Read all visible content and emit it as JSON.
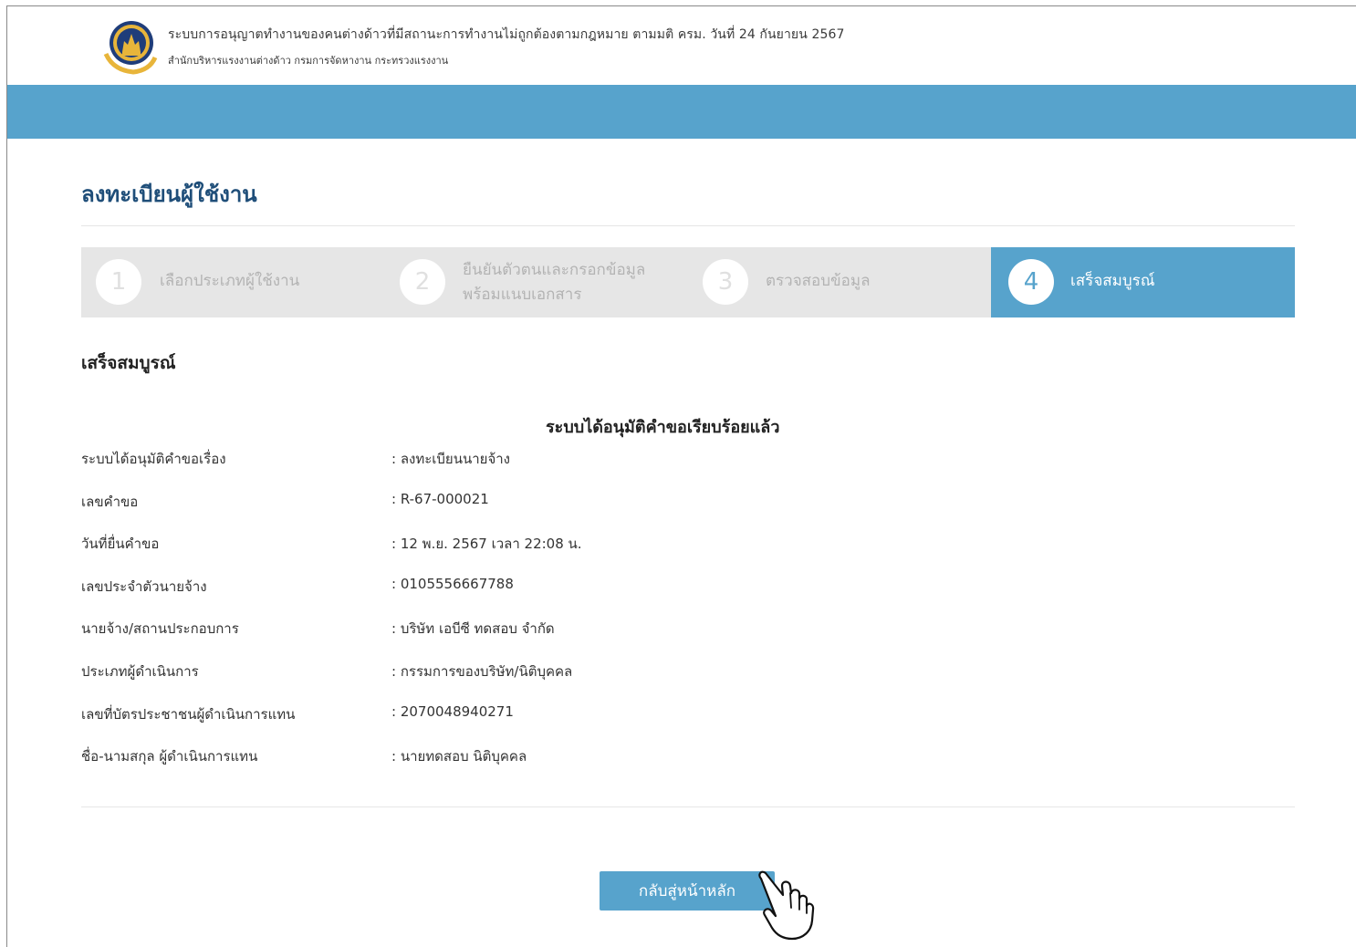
{
  "header": {
    "title": "ระบบการอนุญาตทำงานของคนต่างด้าวที่มีสถานะการทำงานไม่ถูกต้องตามกฎหมาย ตามมติ ครม. วันที่ 24 กันยายน 2567",
    "subtitle": "สำนักบริหารแรงงานต่างด้าว  กรมการจัดหางาน  กระทรวงแรงงาน",
    "logo_icon": "department-seal-icon"
  },
  "page": {
    "title": "ลงทะเบียนผู้ใช้งาน"
  },
  "stepper": {
    "steps": [
      {
        "number": "1",
        "label": "เลือกประเภทผู้ใช้งาน",
        "label_line2": "",
        "active": false
      },
      {
        "number": "2",
        "label": "ยืนยันตัวตนและกรอกข้อมูล",
        "label_line2": "พร้อมแนบเอกสาร",
        "active": false
      },
      {
        "number": "3",
        "label": "ตรวจสอบข้อมูล",
        "label_line2": "",
        "active": false
      },
      {
        "number": "4",
        "label": "เสร็จสมบูรณ์",
        "label_line2": "",
        "active": true
      }
    ],
    "active_color": "#57a3cc",
    "inactive_color": "#e6e6e6"
  },
  "result": {
    "heading": "เสร็จสมบูรณ์",
    "message": "ระบบได้อนุมัติคำขอเรียบร้อยแล้ว",
    "details": [
      {
        "label": "ระบบได้อนุมัติคำขอเรื่อง",
        "value": ": ลงทะเบียนนายจ้าง"
      },
      {
        "label": "เลขคำขอ",
        "value": ": R-67-000021"
      },
      {
        "label": "วันที่ยื่นคำขอ",
        "value": ": 12 พ.ย. 2567 เวลา 22:08 น."
      },
      {
        "label": "เลขประจำตัวนายจ้าง",
        "value": ": 0105556667788"
      },
      {
        "label": "นายจ้าง/สถานประกอบการ",
        "value": ": บริษัท เอบีซี ทดสอบ จำกัด"
      },
      {
        "label": "ประเภทผู้ดำเนินการ",
        "value": ": กรรมการของบริษัท/นิติบุคคล"
      },
      {
        "label": "เลขที่บัตรประชาชนผู้ดำเนินการแทน",
        "value": ": 2070048940271"
      },
      {
        "label": "ชื่อ-นามสกุล ผู้ดำเนินการแทน",
        "value": ": นายทดสอบ นิติบุคคล"
      }
    ]
  },
  "actions": {
    "home_label": "กลับสู่หน้าหลัก",
    "cursor_icon": "hand-pointer-icon"
  },
  "colors": {
    "brand_blue": "#57a3cc",
    "title_navy": "#1f4e79"
  }
}
